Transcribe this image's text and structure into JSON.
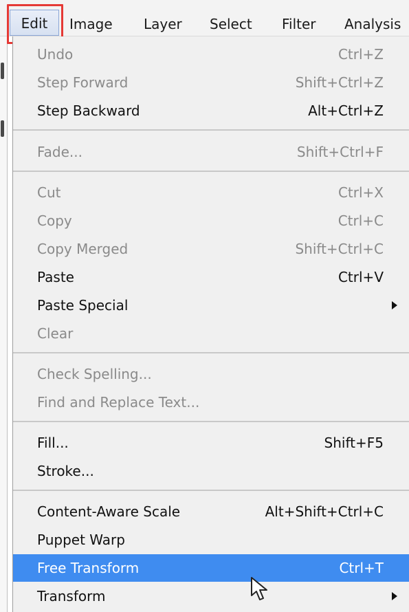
{
  "menu_bar": {
    "items": [
      "Edit",
      "Image",
      "Layer",
      "Select",
      "Filter",
      "Analysis"
    ]
  },
  "edit_menu": {
    "items": [
      {
        "label": "Undo",
        "shortcut": "Ctrl+Z",
        "enabled": false
      },
      {
        "label": "Step Forward",
        "shortcut": "Shift+Ctrl+Z",
        "enabled": false
      },
      {
        "label": "Step Backward",
        "shortcut": "Alt+Ctrl+Z",
        "enabled": true
      },
      {
        "label": "Fade...",
        "shortcut": "Shift+Ctrl+F",
        "enabled": false
      },
      {
        "label": "Cut",
        "shortcut": "Ctrl+X",
        "enabled": false
      },
      {
        "label": "Copy",
        "shortcut": "Ctrl+C",
        "enabled": false
      },
      {
        "label": "Copy Merged",
        "shortcut": "Shift+Ctrl+C",
        "enabled": false
      },
      {
        "label": "Paste",
        "shortcut": "Ctrl+V",
        "enabled": true
      },
      {
        "label": "Paste Special",
        "shortcut": "",
        "enabled": true,
        "submenu": true
      },
      {
        "label": "Clear",
        "shortcut": "",
        "enabled": false
      },
      {
        "label": "Check Spelling...",
        "shortcut": "",
        "enabled": false
      },
      {
        "label": "Find and Replace Text...",
        "shortcut": "",
        "enabled": false
      },
      {
        "label": "Fill...",
        "shortcut": "Shift+F5",
        "enabled": true
      },
      {
        "label": "Stroke...",
        "shortcut": "",
        "enabled": true
      },
      {
        "label": "Content-Aware Scale",
        "shortcut": "Alt+Shift+Ctrl+C",
        "enabled": true
      },
      {
        "label": "Puppet Warp",
        "shortcut": "",
        "enabled": true
      },
      {
        "label": "Free Transform",
        "shortcut": "Ctrl+T",
        "enabled": true,
        "selected": true
      },
      {
        "label": "Transform",
        "shortcut": "",
        "enabled": true,
        "submenu": true
      }
    ]
  },
  "colors": {
    "highlight_box": "#e53935",
    "selection": "#3f8cf0"
  },
  "icons": {
    "submenu": "chevron-right-icon",
    "cursor": "cursor-arrow-icon"
  }
}
